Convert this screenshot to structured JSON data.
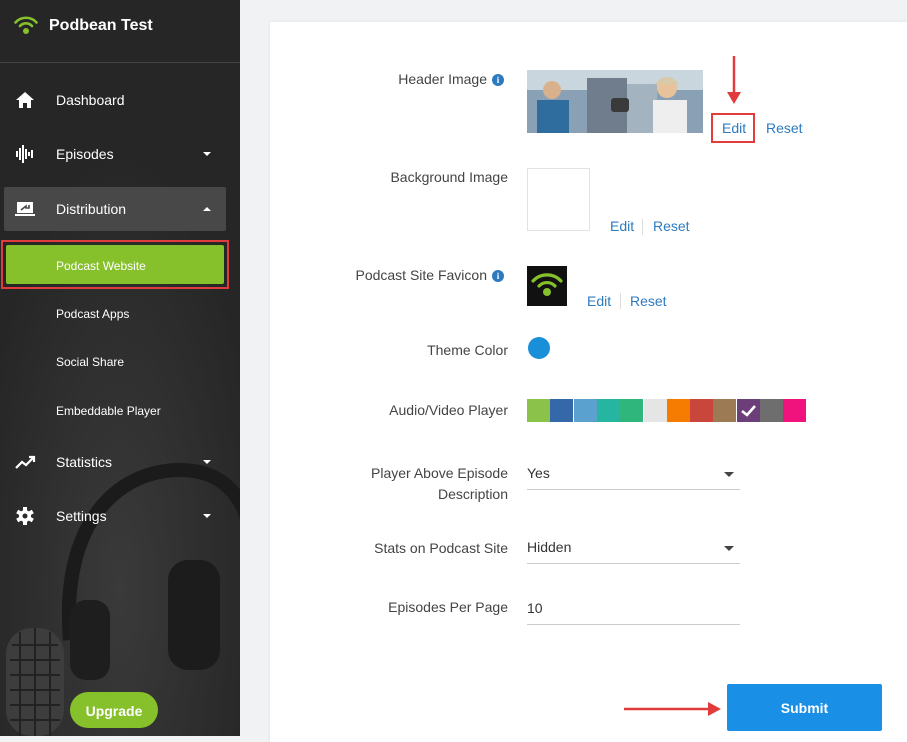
{
  "sidebar": {
    "brand": "Podbean Test",
    "nav": [
      {
        "label": "Dashboard",
        "icon": "home-icon"
      },
      {
        "label": "Episodes",
        "icon": "audio-wave-icon"
      },
      {
        "label": "Distribution",
        "icon": "laptop-share-icon"
      },
      {
        "label": "Statistics",
        "icon": "trend-chart-icon"
      },
      {
        "label": "Settings",
        "icon": "gear-icon"
      }
    ],
    "sub": [
      "Podcast Website",
      "Podcast Apps",
      "Social Share",
      "Embeddable Player"
    ],
    "upgrade": "Upgrade"
  },
  "form": {
    "header_image": {
      "label": "Header Image",
      "edit": "Edit",
      "reset": "Reset"
    },
    "background_image": {
      "label": "Background Image",
      "edit": "Edit",
      "reset": "Reset"
    },
    "favicon": {
      "label": "Podcast Site Favicon",
      "edit": "Edit",
      "reset": "Reset"
    },
    "theme_color": {
      "label": "Theme Color",
      "value": "#1a8fd9"
    },
    "player": {
      "label": "Audio/Video Player",
      "colors": [
        "#8bc34a",
        "#3568a8",
        "#5ba1cf",
        "#26b5a0",
        "#2eb67d",
        "#e5e5e5",
        "#f57c00",
        "#c9463d",
        "#9c7a54",
        "#6c3f7a",
        "#6e6e6e",
        "#f0127d"
      ],
      "selected_index": 9
    },
    "player_above": {
      "label_line1": "Player Above Episode",
      "label_line2": "Description",
      "value": "Yes"
    },
    "stats": {
      "label": "Stats on Podcast Site",
      "value": "Hidden"
    },
    "episodes_per_page": {
      "label": "Episodes Per Page",
      "value": "10"
    },
    "submit": "Submit"
  },
  "colors": {
    "accent_green": "#86c12c",
    "link_blue": "#2d7bbf",
    "submit_blue": "#1a8fe6",
    "annotation_red": "#e03c3c"
  }
}
